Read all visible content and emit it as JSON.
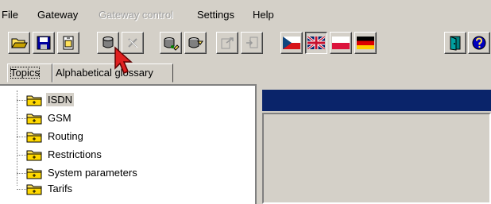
{
  "menu": {
    "file": "File",
    "gateway": "Gateway",
    "gateway_control": "Gateway control",
    "settings": "Settings",
    "help": "Help"
  },
  "toolbar": {
    "buttons": [
      "open-icon",
      "save-icon",
      "import-icon",
      "connect-icon",
      "disconnect-icon",
      "upload-icon",
      "download-icon",
      "export-icon",
      "plugin-icon",
      "flag-czech-icon",
      "flag-uk-icon",
      "flag-poland-icon",
      "flag-germany-icon",
      "exit-icon",
      "help-icon"
    ],
    "gateway_control_disabled": true
  },
  "tabs": [
    {
      "label": "Topics",
      "active": true
    },
    {
      "label": "Alphabetical glossary",
      "active": false
    }
  ],
  "tree": {
    "items": [
      {
        "label": "ISDN",
        "selected": true
      },
      {
        "label": "GSM",
        "selected": false
      },
      {
        "label": "Routing",
        "selected": false
      },
      {
        "label": "Restrictions",
        "selected": false
      },
      {
        "label": "System parameters",
        "selected": false
      },
      {
        "label": "Tarifs",
        "selected": false
      }
    ]
  },
  "colors": {
    "face": "#d4d0c8",
    "titlebar": "#0a246a",
    "folder": "#ffe25a",
    "cursor": "#e02020"
  }
}
